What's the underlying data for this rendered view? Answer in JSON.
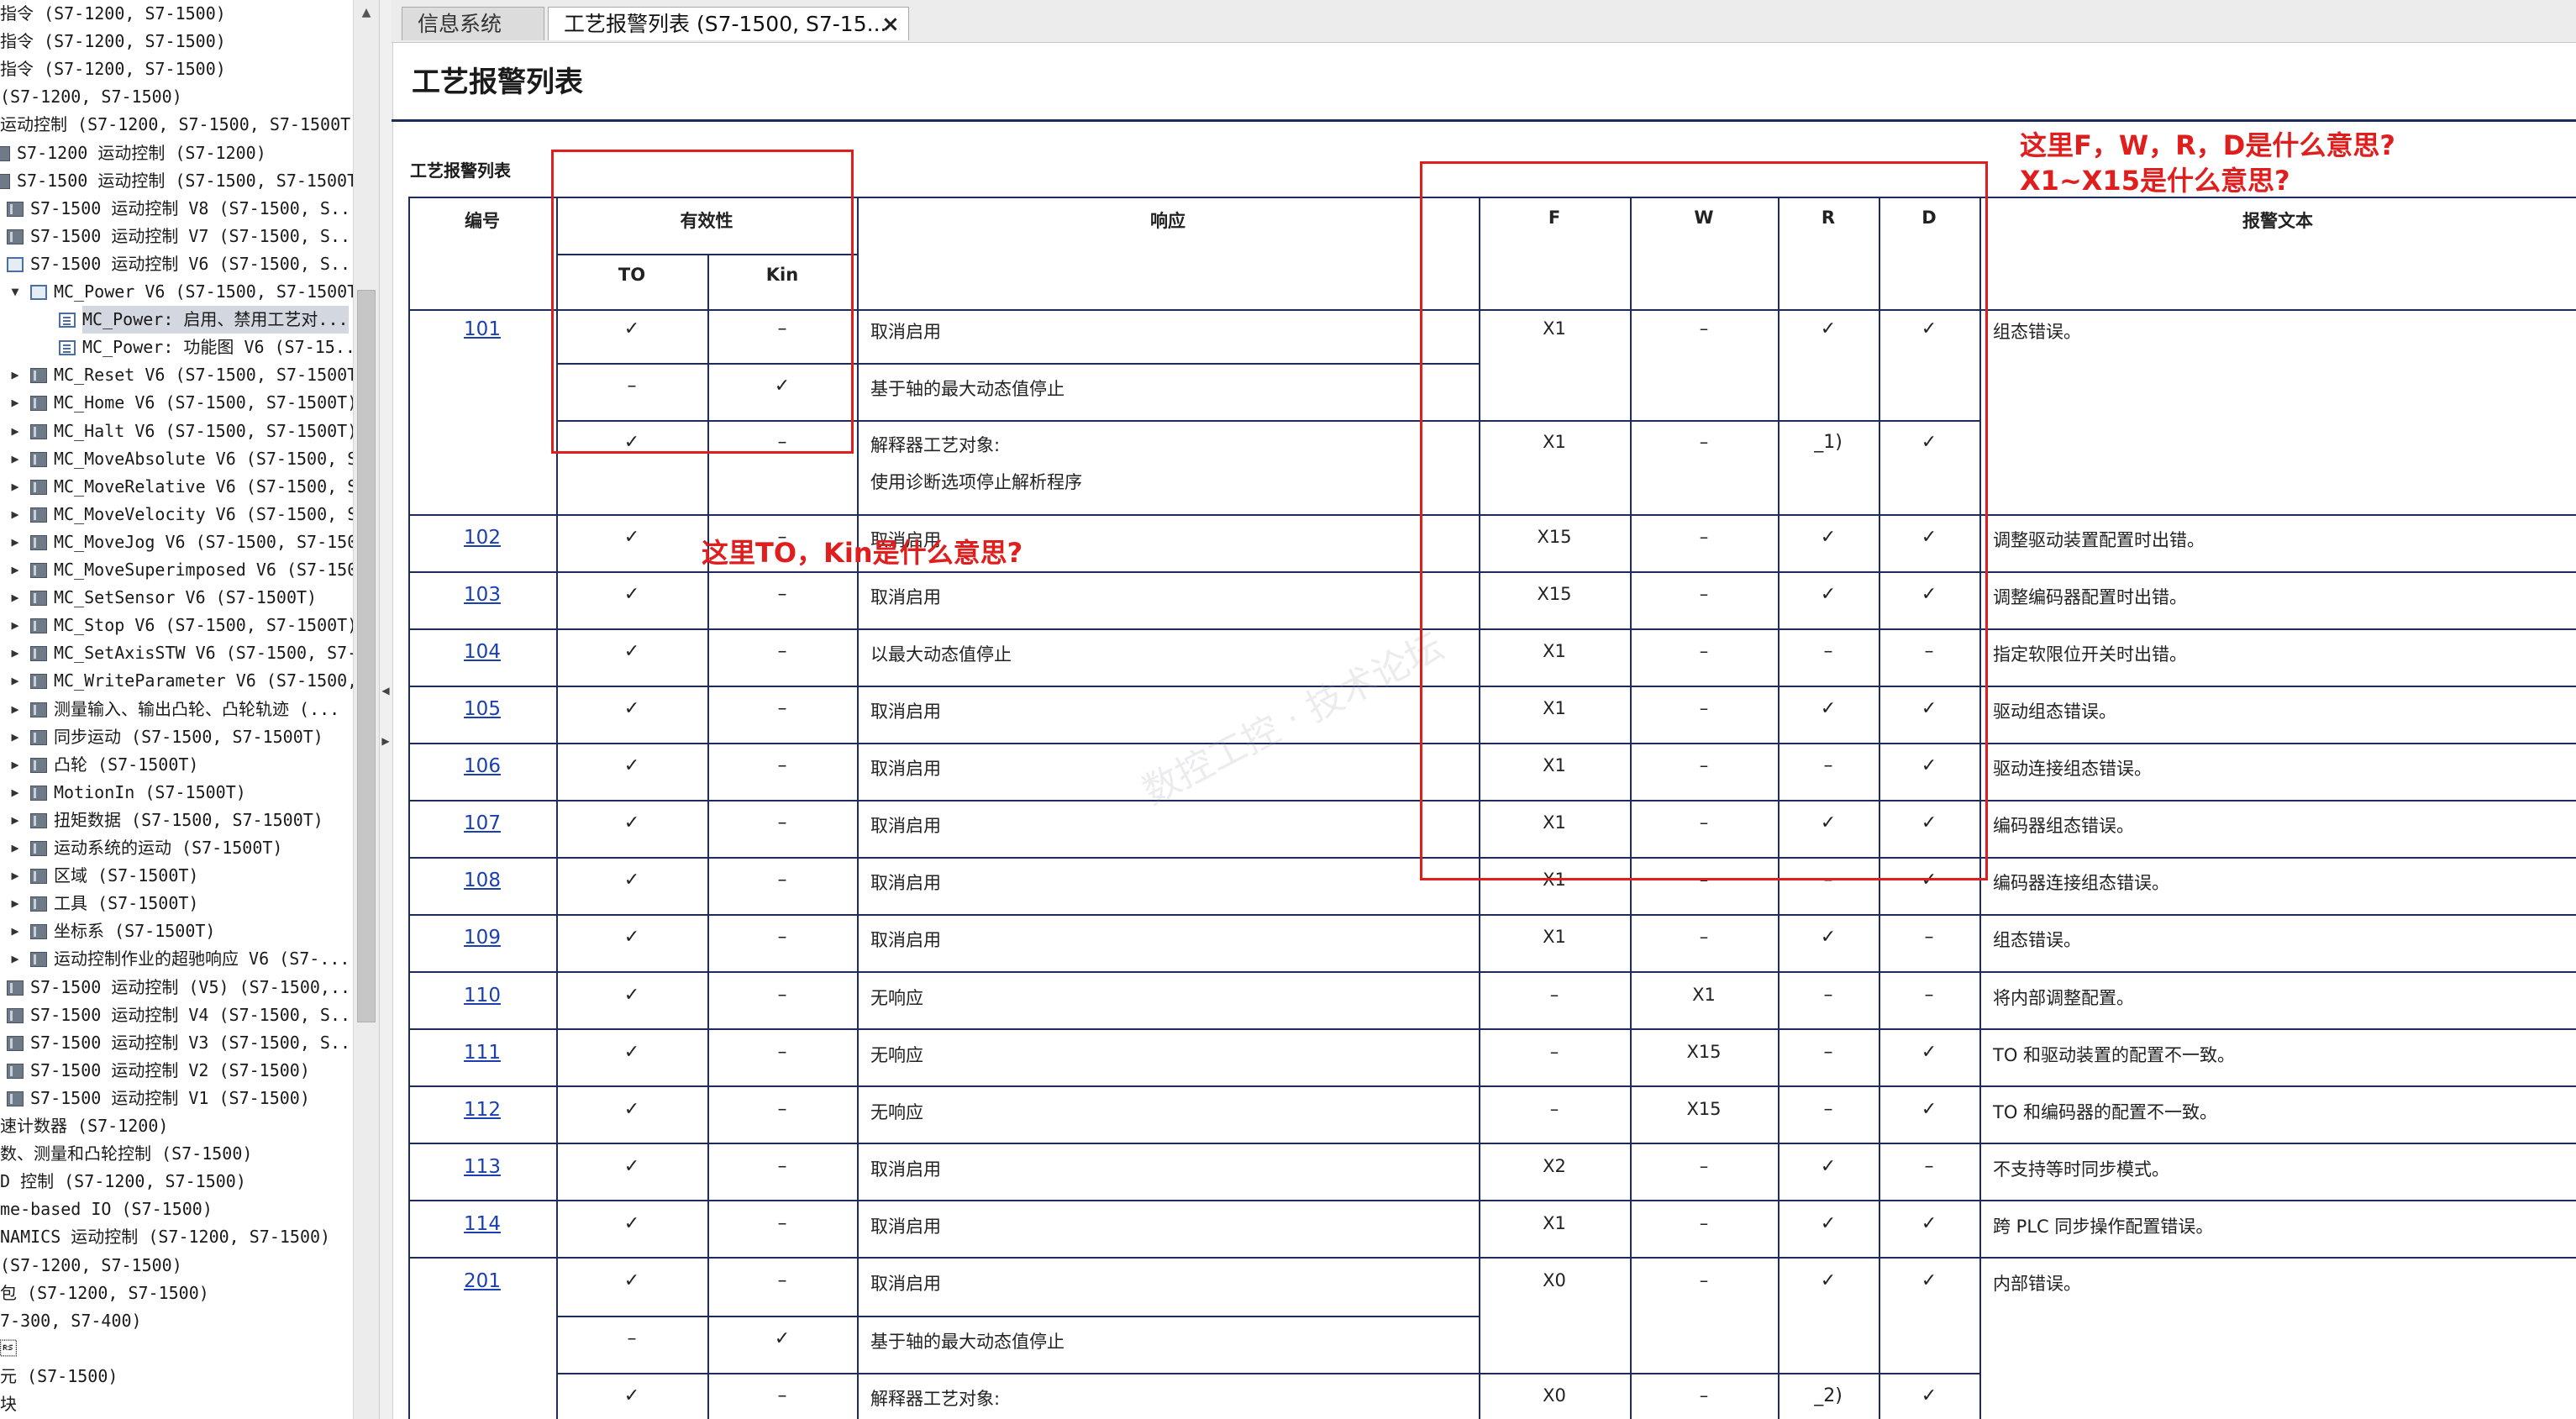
{
  "nav": {
    "items": [
      {
        "label": "指令 (S7-1200, S7-1500)",
        "indent": 0,
        "arrow": "",
        "icon": "none"
      },
      {
        "label": "指令 (S7-1200, S7-1500)",
        "indent": 0,
        "arrow": "",
        "icon": "none"
      },
      {
        "label": "指令 (S7-1200, S7-1500)",
        "indent": 0,
        "arrow": "",
        "icon": "none"
      },
      {
        "label": " (S7-1200, S7-1500)",
        "indent": 0,
        "arrow": "",
        "icon": "none"
      },
      {
        "label": "运动控制 (S7-1200, S7-1500, S7-1500T)",
        "indent": 0,
        "arrow": "",
        "icon": "none"
      },
      {
        "label": "S7-1200 运动控制 (S7-1200)",
        "indent": 0,
        "arrow": "",
        "icon": "book-partial"
      },
      {
        "label": "S7-1500 运动控制 (S7-1500, S7-1500T)",
        "indent": 0,
        "arrow": "",
        "icon": "book-partial"
      },
      {
        "label": "S7-1500 运动控制 V8 (S7-1500, S...",
        "indent": 1,
        "arrow": "",
        "icon": "book"
      },
      {
        "label": "S7-1500 运动控制 V7 (S7-1500, S...",
        "indent": 1,
        "arrow": "",
        "icon": "book"
      },
      {
        "label": "S7-1500 运动控制 V6 (S7-1500, S...",
        "indent": 1,
        "arrow": "",
        "icon": "openbook"
      },
      {
        "label": "MC_Power V6 (S7-1500, S7-1500T)",
        "indent": 2,
        "arrow": "▼",
        "icon": "openbook"
      },
      {
        "label": "MC_Power: 启用、禁用工艺对...",
        "indent": 3,
        "arrow": "",
        "icon": "page",
        "selected": true
      },
      {
        "label": "MC_Power: 功能图 V6 (S7-15...",
        "indent": 3,
        "arrow": "",
        "icon": "page"
      },
      {
        "label": "MC_Reset V6 (S7-1500, S7-1500T)",
        "indent": 2,
        "arrow": "▶",
        "icon": "book"
      },
      {
        "label": "MC_Home V6 (S7-1500, S7-1500T)",
        "indent": 2,
        "arrow": "▶",
        "icon": "book"
      },
      {
        "label": "MC_Halt V6 (S7-1500, S7-1500T)",
        "indent": 2,
        "arrow": "▶",
        "icon": "book"
      },
      {
        "label": "MC_MoveAbsolute V6 (S7-1500, S...",
        "indent": 2,
        "arrow": "▶",
        "icon": "book"
      },
      {
        "label": "MC_MoveRelative V6 (S7-1500, S...",
        "indent": 2,
        "arrow": "▶",
        "icon": "book"
      },
      {
        "label": "MC_MoveVelocity V6 (S7-1500, S...",
        "indent": 2,
        "arrow": "▶",
        "icon": "book"
      },
      {
        "label": "MC_MoveJog V6 (S7-1500, S7-1500T)",
        "indent": 2,
        "arrow": "▶",
        "icon": "book"
      },
      {
        "label": "MC_MoveSuperimposed V6 (S7-150...",
        "indent": 2,
        "arrow": "▶",
        "icon": "book"
      },
      {
        "label": "MC_SetSensor V6 (S7-1500T)",
        "indent": 2,
        "arrow": "▶",
        "icon": "book"
      },
      {
        "label": "MC_Stop V6 (S7-1500, S7-1500T)",
        "indent": 2,
        "arrow": "▶",
        "icon": "book"
      },
      {
        "label": "MC_SetAxisSTW V6 (S7-1500, S7-...",
        "indent": 2,
        "arrow": "▶",
        "icon": "book"
      },
      {
        "label": "MC_WriteParameter V6 (S7-1500,...",
        "indent": 2,
        "arrow": "▶",
        "icon": "book"
      },
      {
        "label": "测量输入、输出凸轮、凸轮轨迹 (...",
        "indent": 2,
        "arrow": "▶",
        "icon": "book"
      },
      {
        "label": "同步运动 (S7-1500, S7-1500T)",
        "indent": 2,
        "arrow": "▶",
        "icon": "book"
      },
      {
        "label": "凸轮 (S7-1500T)",
        "indent": 2,
        "arrow": "▶",
        "icon": "book"
      },
      {
        "label": "MotionIn (S7-1500T)",
        "indent": 2,
        "arrow": "▶",
        "icon": "book"
      },
      {
        "label": "扭矩数据 (S7-1500, S7-1500T)",
        "indent": 2,
        "arrow": "▶",
        "icon": "book"
      },
      {
        "label": "运动系统的运动 (S7-1500T)",
        "indent": 2,
        "arrow": "▶",
        "icon": "book"
      },
      {
        "label": "区域 (S7-1500T)",
        "indent": 2,
        "arrow": "▶",
        "icon": "book"
      },
      {
        "label": "工具 (S7-1500T)",
        "indent": 2,
        "arrow": "▶",
        "icon": "book"
      },
      {
        "label": "坐标系 (S7-1500T)",
        "indent": 2,
        "arrow": "▶",
        "icon": "book"
      },
      {
        "label": "运动控制作业的超驰响应 V6 (S7-...",
        "indent": 2,
        "arrow": "▶",
        "icon": "book"
      },
      {
        "label": "S7-1500 运动控制 (V5) (S7-1500,...",
        "indent": 1,
        "arrow": "",
        "icon": "book"
      },
      {
        "label": "S7-1500 运动控制 V4 (S7-1500, S...",
        "indent": 1,
        "arrow": "",
        "icon": "book"
      },
      {
        "label": "S7-1500 运动控制 V3 (S7-1500, S...",
        "indent": 1,
        "arrow": "",
        "icon": "book"
      },
      {
        "label": "S7-1500 运动控制 V2 (S7-1500)",
        "indent": 1,
        "arrow": "",
        "icon": "book"
      },
      {
        "label": "S7-1500 运动控制 V1 (S7-1500)",
        "indent": 1,
        "arrow": "",
        "icon": "book"
      },
      {
        "label": "速计数器 (S7-1200)",
        "indent": 0,
        "arrow": "",
        "icon": "none"
      },
      {
        "label": "数、测量和凸轮控制 (S7-1500)",
        "indent": 0,
        "arrow": "",
        "icon": "none"
      },
      {
        "label": "D 控制 (S7-1200, S7-1500)",
        "indent": 0,
        "arrow": "",
        "icon": "none"
      },
      {
        "label": "me-based IO (S7-1500)",
        "indent": 0,
        "arrow": "",
        "icon": "none"
      },
      {
        "label": "NAMICS 运动控制 (S7-1200, S7-1500)",
        "indent": 0,
        "arrow": "",
        "icon": "none"
      },
      {
        "label": " (S7-1200, S7-1500)",
        "indent": 0,
        "arrow": "",
        "icon": "none"
      },
      {
        "label": "包 (S7-1200, S7-1500)",
        "indent": 0,
        "arrow": "",
        "icon": "none"
      },
      {
        "label": "7-300, S7-400)",
        "indent": 0,
        "arrow": "",
        "icon": "none"
      },
      {
        "label": "\u001e",
        "indent": 0,
        "arrow": "",
        "icon": "none"
      },
      {
        "label": "元 (S7-1500)",
        "indent": 0,
        "arrow": "",
        "icon": "none"
      },
      {
        "label": "块",
        "indent": 0,
        "arrow": "",
        "icon": "none"
      }
    ]
  },
  "tabs": [
    {
      "label": "信息系统",
      "active": false
    },
    {
      "label": "工艺报警列表 (S7-1500, S7-15...",
      "active": true,
      "close": "×"
    }
  ],
  "page": {
    "title": "工艺报警列表",
    "caption": "工艺报警列表"
  },
  "table": {
    "headers": {
      "no": "编号",
      "validity": "有效性",
      "to": "TO",
      "kin": "Kin",
      "response": "响应",
      "f": "F",
      "w": "W",
      "r": "R",
      "d": "D",
      "text": "报警文本"
    },
    "rows": [
      {
        "no": "101",
        "to": "✓",
        "kin": "–",
        "response": "取消启用",
        "f": "X1",
        "w": "–",
        "r": "✓",
        "d": "✓",
        "text": "组态错误。"
      },
      {
        "no": "",
        "to": "–",
        "kin": "✓",
        "response": "基于轴的最大动态值停止",
        "f": "",
        "w": "",
        "r": "",
        "d": "",
        "text": ""
      },
      {
        "no": "",
        "to": "✓",
        "kin": "–",
        "response": "解释器工艺对象:",
        "response2": "使用诊断选项停止解析程序",
        "f": "X1",
        "w": "–",
        "r": "_1)",
        "d": "✓",
        "text": ""
      },
      {
        "no": "102",
        "to": "✓",
        "kin": "–",
        "response": "取消启用",
        "f": "X15",
        "w": "–",
        "r": "✓",
        "d": "✓",
        "text": "调整驱动装置配置时出错。"
      },
      {
        "no": "103",
        "to": "✓",
        "kin": "–",
        "response": "取消启用",
        "f": "X15",
        "w": "–",
        "r": "✓",
        "d": "✓",
        "text": "调整编码器配置时出错。"
      },
      {
        "no": "104",
        "to": "✓",
        "kin": "–",
        "response": "以最大动态值停止",
        "f": "X1",
        "w": "–",
        "r": "–",
        "d": "–",
        "text": "指定软限位开关时出错。"
      },
      {
        "no": "105",
        "to": "✓",
        "kin": "–",
        "response": "取消启用",
        "f": "X1",
        "w": "–",
        "r": "✓",
        "d": "✓",
        "text": "驱动组态错误。"
      },
      {
        "no": "106",
        "to": "✓",
        "kin": "–",
        "response": "取消启用",
        "f": "X1",
        "w": "–",
        "r": "–",
        "d": "✓",
        "text": "驱动连接组态错误。"
      },
      {
        "no": "107",
        "to": "✓",
        "kin": "–",
        "response": "取消启用",
        "f": "X1",
        "w": "–",
        "r": "✓",
        "d": "✓",
        "text": "编码器组态错误。"
      },
      {
        "no": "108",
        "to": "✓",
        "kin": "–",
        "response": "取消启用",
        "f": "X1",
        "w": "–",
        "r": "–",
        "d": "✓",
        "text": "编码器连接组态错误。"
      },
      {
        "no": "109",
        "to": "✓",
        "kin": "–",
        "response": "取消启用",
        "f": "X1",
        "w": "–",
        "r": "✓",
        "d": "–",
        "text": "组态错误。"
      },
      {
        "no": "110",
        "to": "✓",
        "kin": "–",
        "response": "无响应",
        "f": "–",
        "w": "X1",
        "r": "–",
        "d": "–",
        "text": "将内部调整配置。"
      },
      {
        "no": "111",
        "to": "✓",
        "kin": "–",
        "response": "无响应",
        "f": "–",
        "w": "X15",
        "r": "–",
        "d": "✓",
        "text": "TO 和驱动装置的配置不一致。"
      },
      {
        "no": "112",
        "to": "✓",
        "kin": "–",
        "response": "无响应",
        "f": "–",
        "w": "X15",
        "r": "–",
        "d": "✓",
        "text": "TO 和编码器的配置不一致。"
      },
      {
        "no": "113",
        "to": "✓",
        "kin": "–",
        "response": "取消启用",
        "f": "X2",
        "w": "–",
        "r": "✓",
        "d": "–",
        "text": "不支持等时同步模式。"
      },
      {
        "no": "114",
        "to": "✓",
        "kin": "–",
        "response": "取消启用",
        "f": "X1",
        "w": "–",
        "r": "✓",
        "d": "✓",
        "text": "跨 PLC 同步操作配置错误。"
      },
      {
        "no": "201",
        "to": "✓",
        "kin": "–",
        "response": "取消启用",
        "f": "X0",
        "w": "–",
        "r": "✓",
        "d": "✓",
        "text": "内部错误。"
      },
      {
        "no": "",
        "to": "–",
        "kin": "✓",
        "response": "基于轴的最大动态值停止",
        "f": "",
        "w": "",
        "r": "",
        "d": "",
        "text": ""
      },
      {
        "no": "",
        "to": "✓",
        "kin": "–",
        "response": "解释器工艺对象:",
        "f": "X0",
        "w": "–",
        "r": "_2)",
        "d": "✓",
        "text": ""
      }
    ]
  },
  "annotations": {
    "q_fwrd_line1": "这里F，W，R，D是什么意思?",
    "q_fwrd_line2": "X1~X15是什么意思?",
    "q_tokin": "这里TO，Kin是什么意思?",
    "color": "#e01e1e"
  },
  "colors": {
    "rule": "#1e2c5a",
    "link": "#1a3fb0",
    "selected": "#d3d8e0"
  }
}
